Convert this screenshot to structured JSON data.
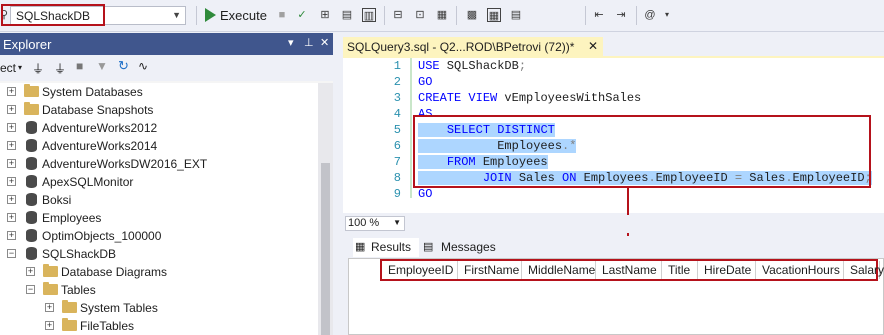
{
  "toolbar": {
    "database": "SQLShackDB",
    "execute_label": "Execute"
  },
  "explorer": {
    "title": "Explorer",
    "connect_label": "ect",
    "tree": [
      {
        "label": "System Databases",
        "type": "folder"
      },
      {
        "label": "Database Snapshots",
        "type": "folder"
      },
      {
        "label": "AdventureWorks2012",
        "type": "db"
      },
      {
        "label": "AdventureWorks2014",
        "type": "db"
      },
      {
        "label": "AdventureWorksDW2016_EXT",
        "type": "db"
      },
      {
        "label": "ApexSQLMonitor",
        "type": "db"
      },
      {
        "label": "Boksi",
        "type": "db"
      },
      {
        "label": "Employees",
        "type": "db"
      },
      {
        "label": "OptimObjects_100000",
        "type": "db"
      },
      {
        "label": "SQLShackDB",
        "type": "db"
      },
      {
        "label": "Database Diagrams",
        "type": "folder"
      },
      {
        "label": "Tables",
        "type": "folder"
      },
      {
        "label": "System Tables",
        "type": "folder"
      },
      {
        "label": "FileTables",
        "type": "folder"
      }
    ]
  },
  "editor": {
    "tab_title": "SQLQuery3.sql - Q2...ROD\\BPetrovi (72))*",
    "lines": [
      {
        "num": "1",
        "code": "USE SQLShackDB;"
      },
      {
        "num": "2",
        "code": "GO"
      },
      {
        "num": "3",
        "code": "CREATE VIEW vEmployeesWithSales"
      },
      {
        "num": "4",
        "code": "AS"
      },
      {
        "num": "5",
        "code": "    SELECT DISTINCT"
      },
      {
        "num": "6",
        "code": "           Employees.*"
      },
      {
        "num": "7",
        "code": "    FROM Employees"
      },
      {
        "num": "8",
        "code": "         JOIN Sales ON Employees.EmployeeID = Sales.EmployeeID;"
      },
      {
        "num": "9",
        "code": "GO"
      }
    ]
  },
  "zoom": "100 %",
  "results": {
    "tab_results": "Results",
    "tab_messages": "Messages",
    "columns": [
      "EmployeeID",
      "FirstName",
      "MiddleName",
      "LastName",
      "Title",
      "HireDate",
      "VacationHours",
      "Salary"
    ]
  }
}
